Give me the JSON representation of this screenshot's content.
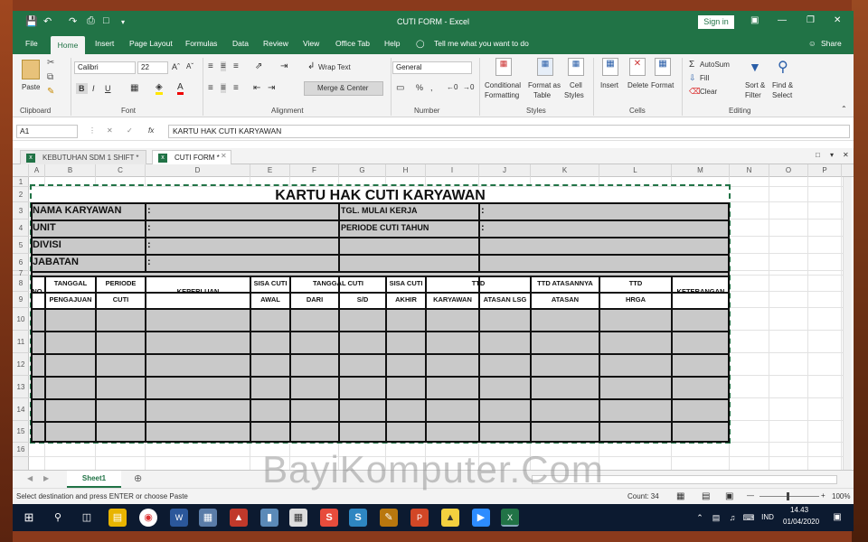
{
  "window": {
    "title": "CUTI FORM  -  Excel",
    "sign_in": "Sign in",
    "share": "Share",
    "tell_me": "Tell me what you want to do"
  },
  "menu_tabs": [
    "File",
    "Home",
    "Insert",
    "Page Layout",
    "Formulas",
    "Data",
    "Review",
    "View",
    "Office Tab",
    "Help"
  ],
  "ribbon": {
    "clipboard": {
      "paste": "Paste",
      "group": "Clipboard"
    },
    "font": {
      "name": "Calibri",
      "size": "22",
      "group": "Font"
    },
    "alignment": {
      "wrap": "Wrap Text",
      "merge": "Merge & Center",
      "group": "Alignment"
    },
    "number": {
      "format": "General",
      "group": "Number"
    },
    "styles": {
      "conditional_1": "Conditional",
      "conditional_2": "Formatting",
      "format_as_1": "Format as",
      "format_as_2": "Table",
      "cell_styles_1": "Cell",
      "cell_styles_2": "Styles",
      "group": "Styles"
    },
    "cells": {
      "insert": "Insert",
      "delete": "Delete",
      "format": "Format",
      "group": "Cells"
    },
    "editing": {
      "autosum": "AutoSum",
      "fill": "Fill",
      "clear": "Clear",
      "sort_1": "Sort &",
      "sort_2": "Filter",
      "find_1": "Find &",
      "find_2": "Select",
      "group": "Editing"
    }
  },
  "formula_bar": {
    "name_box": "A1",
    "fx": "fx",
    "content": "KARTU HAK CUTI KARYAWAN"
  },
  "workbook_tabs": [
    {
      "label": "KEBUTUHAN SDM 1 SHIFT *",
      "active": false
    },
    {
      "label": "CUTI FORM *",
      "active": true
    }
  ],
  "columns": [
    "A",
    "B",
    "C",
    "D",
    "E",
    "F",
    "G",
    "H",
    "I",
    "J",
    "K",
    "L",
    "M",
    "N",
    "O",
    "P"
  ],
  "rows": [
    "1",
    "2",
    "3",
    "4",
    "5",
    "6",
    "7",
    "8",
    "9",
    "10",
    "11",
    "12",
    "13",
    "14",
    "15",
    "16"
  ],
  "form": {
    "title": "KARTU HAK CUTI KARYAWAN",
    "fields_left": [
      "NAMA KARYAWAN",
      "UNIT",
      "DIVISI",
      "JABATAN"
    ],
    "fields_right": [
      "TGL. MULAI KERJA",
      "PERIODE CUTI TAHUN"
    ],
    "colon": ":",
    "header_top": [
      "NO",
      "TANGGAL",
      "PERIODE",
      "KEPERLUAN",
      "SISA CUTI",
      "TANGGAL CUTI",
      "SISA CUTI",
      "TTD",
      "TTD  ATASANNYA",
      "TTD",
      "KETERANGAN"
    ],
    "header_bottom": [
      "PENGAJUAN",
      "CUTI",
      "AWAL",
      "DARI",
      "S/D",
      "AKHIR",
      "KARYAWAN",
      "ATASAN LSG",
      "ATASAN",
      "HRGA"
    ]
  },
  "sheet_tab": "Sheet1",
  "status": {
    "message": "Select destination and press ENTER or choose Paste",
    "count": "Count: 34",
    "zoom": "100%"
  },
  "watermark": "BayiKomputer.Com",
  "taskbar": {
    "lang": "IND",
    "time": "14.43",
    "date": "01/04/2020"
  }
}
